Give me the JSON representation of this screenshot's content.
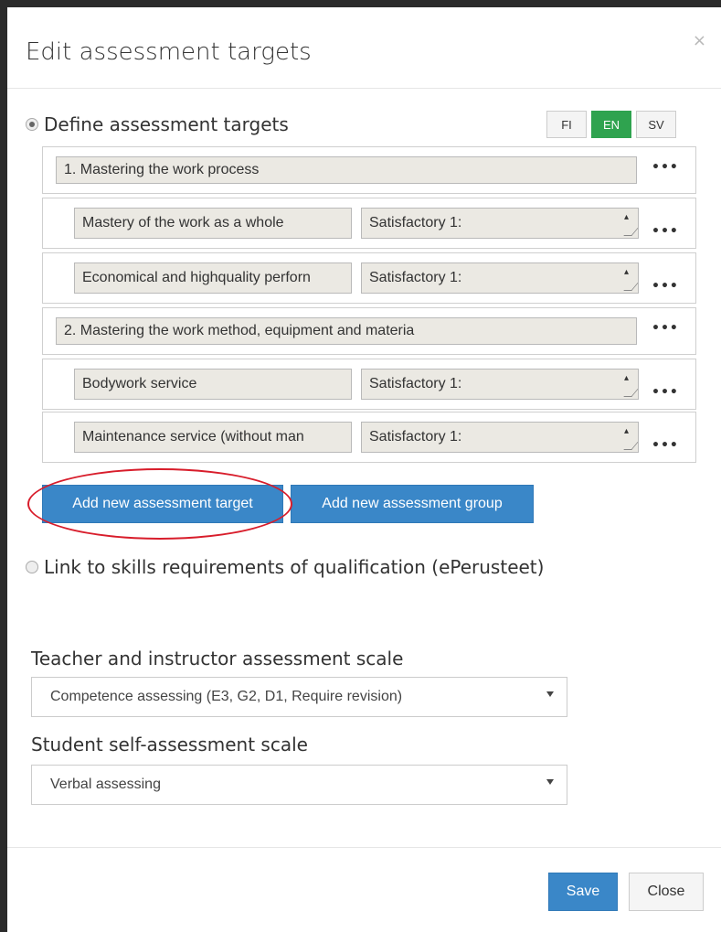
{
  "modal": {
    "title": "Edit assessment targets",
    "close_symbol": "×"
  },
  "options": {
    "define_targets": {
      "label": "Define assessment targets",
      "selected": true
    },
    "link_requirements": {
      "label": "Link to skills requirements of qualification (ePerusteet)",
      "selected": false
    }
  },
  "languages": [
    {
      "code": "FI",
      "active": false
    },
    {
      "code": "EN",
      "active": true
    },
    {
      "code": "SV",
      "active": false
    }
  ],
  "assessment": {
    "groups": [
      {
        "name": "1. Mastering the work process",
        "targets": [
          {
            "name": "Mastery of the work as a whole",
            "criteria": "Satisfactory 1:"
          },
          {
            "name": "Economical and highquality perforn",
            "criteria": "Satisfactory 1:"
          }
        ]
      },
      {
        "name": "2. Mastering the work method, equipment and materia",
        "targets": [
          {
            "name": "Bodywork service",
            "criteria": "Satisfactory 1:"
          },
          {
            "name": "Maintenance service (without  man",
            "criteria": "Satisfactory 1:"
          }
        ]
      }
    ],
    "more_symbol": "•••"
  },
  "actions": {
    "add_target": "Add new assessment target",
    "add_group": "Add new assessment group"
  },
  "scales": {
    "teacher": {
      "label": "Teacher and instructor assessment scale",
      "value": "Competence assessing (E3, G2, D1, Require revision)"
    },
    "student": {
      "label": "Student self-assessment scale",
      "value": "Verbal assessing"
    }
  },
  "footer": {
    "save": "Save",
    "close": "Close"
  },
  "colors": {
    "primary": "#3a87c8",
    "active_lang": "#2fa34f",
    "highlight": "#d81d2b"
  }
}
